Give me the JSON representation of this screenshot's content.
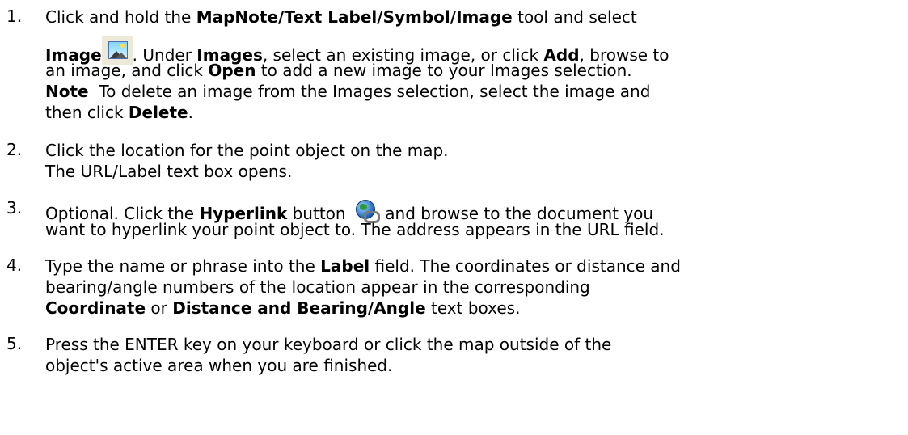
{
  "steps": [
    {
      "number": "1.",
      "l1_pre": "Click and hold the ",
      "l1_b1": "MapNote/Text Label/Symbol/Image",
      "l1_post": " tool and select",
      "l2_b1": "Image",
      "l2_mid1": ". Under ",
      "l2_b2": "Images",
      "l2_mid2": ", select an existing image, or click ",
      "l2_b3": "Add",
      "l2_post": ", browse to",
      "l3_pre": "an image, and click ",
      "l3_b1": "Open",
      "l3_post": " to add a new image to your Images selection.",
      "l4_b1": "Note",
      "l4_post": "  To delete an image from the Images selection, select the image and",
      "l5_pre": "then click ",
      "l5_b1": "Delete",
      "l5_post": "."
    },
    {
      "number": "2.",
      "l1": "Click the location for the point object on the map.",
      "l2": "The URL/Label text box opens."
    },
    {
      "number": "3.",
      "l1_pre": "Optional. Click the ",
      "l1_b1": "Hyperlink",
      "l1_mid": " button ",
      "l1_post": " and browse to the document you",
      "l2": "want to hyperlink your point object to. The address appears in the URL field."
    },
    {
      "number": "4.",
      "l1_pre": "Type the name or phrase into the ",
      "l1_b1": "Label",
      "l1_post": " field. The coordinates or distance and",
      "l2": "bearing/angle numbers of the location appear in the corresponding",
      "l3_b1": "Coordinate",
      "l3_mid": " or ",
      "l3_b2": "Distance and Bearing/Angle",
      "l3_post": " text boxes."
    },
    {
      "number": "5.",
      "l1": "Press the ENTER key on your keyboard or click the map outside of the",
      "l2": "object's active area when you are finished."
    }
  ],
  "icons": {
    "image_icon": "image-icon",
    "hyperlink_icon": "hyperlink-globe-icon"
  }
}
